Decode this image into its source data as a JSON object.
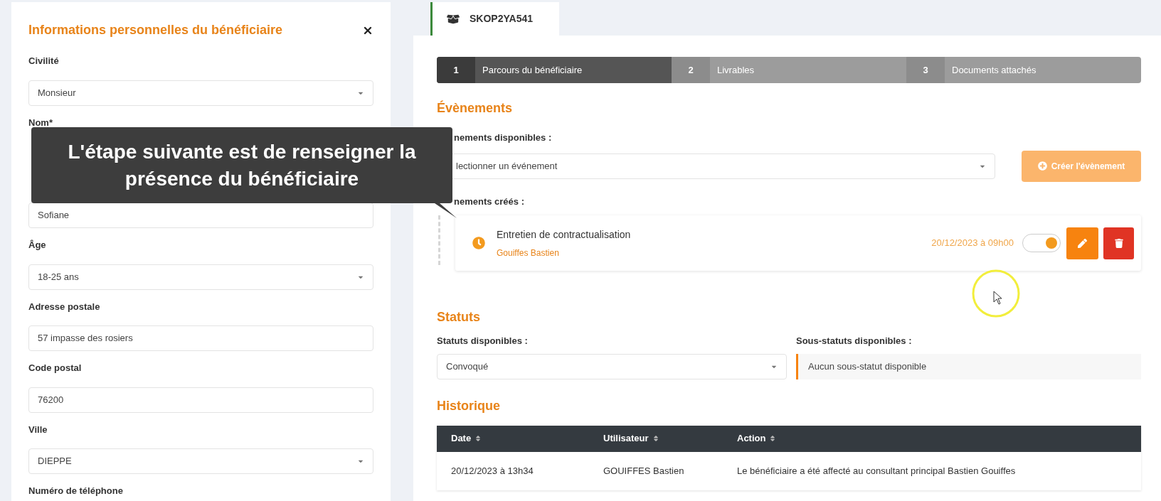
{
  "panel": {
    "title": "Informations personnelles du bénéficiaire",
    "fields": [
      {
        "label": "Civilité",
        "kind": "select",
        "value": "Monsieur"
      },
      {
        "label": "Nom*",
        "kind": "covered"
      },
      {
        "kind": "input",
        "value": "Sofiane"
      },
      {
        "label": "Âge",
        "kind": "select",
        "value": "18-25 ans"
      },
      {
        "label": "Adresse postale",
        "kind": "input",
        "value": "57 impasse des rosiers"
      },
      {
        "label": "Code postal",
        "kind": "input",
        "value": "76200"
      },
      {
        "label": "Ville",
        "kind": "select",
        "value": "DIEPPE"
      },
      {
        "label": "Numéro de téléphone",
        "kind": "input"
      }
    ]
  },
  "callout": {
    "text": "L'étape suivante est de renseigner la présence du bénéficiaire"
  },
  "record_tab": {
    "label": "SKOP2YA541",
    "selected": true
  },
  "steps": [
    {
      "number": "1",
      "label": "Parcours du bénéficiaire",
      "selected": true
    },
    {
      "number": "2",
      "label": "Livrables",
      "selected": false
    },
    {
      "number": "3",
      "label": "Documents attachés",
      "selected": false
    }
  ],
  "events": {
    "heading": "Évènements",
    "available_label": "nements disponibles :",
    "select_value": "lectionner un événement",
    "create_button": "Créer l'évènement",
    "created_label": "nements créés :",
    "items": [
      {
        "title": "Entretien de contractualisation",
        "author": "Gouiffes Bastien",
        "datetime": "20/12/2023 à 09h00",
        "on": true
      }
    ]
  },
  "statuses": {
    "heading": "Statuts",
    "available_label": "Statuts disponibles :",
    "select_value": "Convoqué",
    "sub_label": "Sous-statuts disponibles :",
    "sub_value": "Aucun sous-statut disponible"
  },
  "history": {
    "heading": "Historique",
    "columns": [
      "Date",
      "Utilisateur",
      "Action"
    ],
    "rows": [
      [
        "20/12/2023 à 13h34",
        "GOUIFFES Bastien",
        "Le bénéficiaire a été affecté au consultant principal Bastien Gouiffes"
      ]
    ]
  }
}
